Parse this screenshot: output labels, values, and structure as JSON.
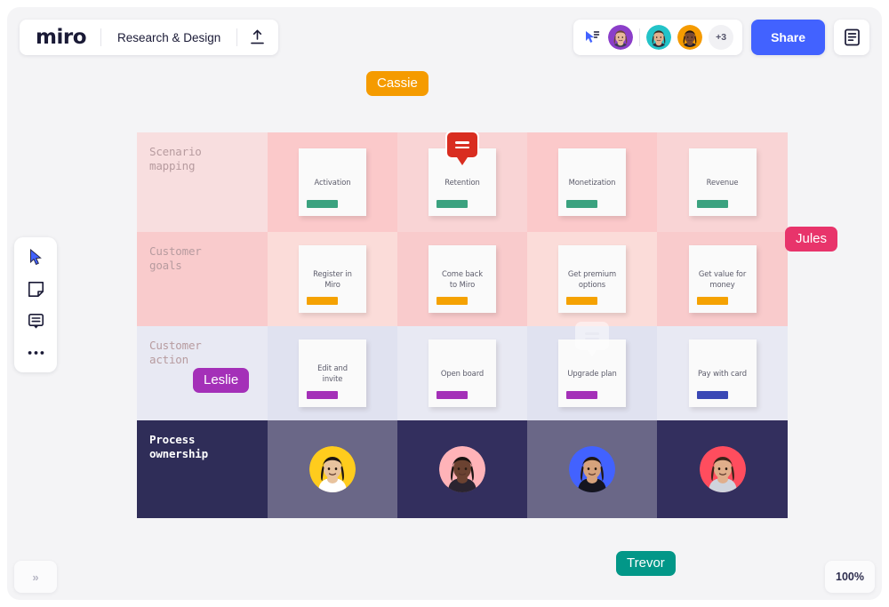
{
  "header": {
    "logo": "miro",
    "board_name": "Research & Design",
    "upload_icon": "upload-icon",
    "follow_icon": "follow-cursor-icon",
    "share_label": "Share",
    "notes_icon": "notes-panel-icon",
    "overflow_count": "+3",
    "collaborators": [
      {
        "name": "collaborator-1",
        "ring": "#8b3ec9",
        "skin": "#e8b99a",
        "hair": "#6d4535",
        "shirt": "#3d3d55"
      },
      {
        "name": "collaborator-2",
        "ring": "#23c3c8",
        "skin": "#e2b08e",
        "hair": "#3a2a22",
        "shirt": "#2a2a3a"
      },
      {
        "name": "collaborator-3",
        "ring": "#f59b00",
        "skin": "#7a4b34",
        "hair": "#231510",
        "shirt": "#1e1e2c"
      }
    ]
  },
  "toolbar": {
    "items": [
      {
        "name": "select-tool",
        "icon": "cursor-icon",
        "active": true
      },
      {
        "name": "sticky-note-tool",
        "icon": "sticky-note-icon",
        "active": false
      },
      {
        "name": "comment-tool",
        "icon": "comment-icon",
        "active": false
      },
      {
        "name": "more-tools",
        "icon": "ellipsis-icon",
        "active": false
      }
    ]
  },
  "footer": {
    "expand_icon": "chevron-double-right-icon",
    "zoom_level": "100%"
  },
  "matrix": {
    "rows": [
      {
        "label": "Scenario\nmapping",
        "label_style": "light",
        "header_bg": "#f8dedf",
        "cell_bgs": [
          "#fbc9ca",
          "#f9d4d5",
          "#fbc9ca",
          "#f9d4d5"
        ],
        "cards": [
          {
            "text": "Activation",
            "bar_color": "#3ba27f",
            "badge": null
          },
          {
            "text": "Retention",
            "bar_color": "#3ba27f",
            "badge": {
              "type": "comment-badge",
              "color": "#d92d20"
            }
          },
          {
            "text": "Monetization",
            "bar_color": "#3ba27f",
            "badge": null
          },
          {
            "text": "Revenue",
            "bar_color": "#3ba27f",
            "badge": null
          }
        ]
      },
      {
        "label": "Customer\ngoals",
        "label_style": "light",
        "header_bg": "#f9cbcc",
        "cell_bgs": [
          "#fbdcd9",
          "#f9cbcc",
          "#fbdcd9",
          "#f9cbcc"
        ],
        "cards": [
          {
            "text": "Register in\nMiro",
            "bar_color": "#f5a202",
            "badge": null
          },
          {
            "text": "Come back\nto Miro",
            "bar_color": "#f5a202",
            "badge": null
          },
          {
            "text": "Get premium\noptions",
            "bar_color": "#f5a202",
            "badge": null
          },
          {
            "text": "Get value for\nmoney",
            "bar_color": "#f5a202",
            "badge": null
          }
        ]
      },
      {
        "label": "Customer\naction",
        "label_style": "light",
        "header_bg": "#e8e9f3",
        "cell_bgs": [
          "#e0e2f0",
          "#e8e9f3",
          "#e0e2f0",
          "#e8e9f3"
        ],
        "cards": [
          {
            "text": "Edit and\ninvite",
            "bar_color": "#a430b8",
            "badge": null
          },
          {
            "text": "Open board",
            "bar_color": "#a430b8",
            "badge": null
          },
          {
            "text": "Upgrade plan",
            "bar_color": "#a430b8",
            "badge": {
              "type": "comment-badge-placeholder",
              "color": "#ffffff"
            }
          },
          {
            "text": "Pay with card",
            "bar_color": "#3a48b5",
            "badge": null
          }
        ]
      },
      {
        "label": "Process\nownership",
        "label_style": "dark",
        "header_bg": "#2f2d58",
        "cell_bgs": [
          "#6a6787",
          "#332f5e",
          "#6a6787",
          "#332f5e"
        ],
        "owners": [
          {
            "name": "owner-avatar-1",
            "ring": "#ffcc1d",
            "skin": "#e8c39e",
            "hair": "#1c1512",
            "shirt": "#ffffff"
          },
          {
            "name": "owner-avatar-2",
            "ring": "#ffb3b8",
            "skin": "#6b4231",
            "hair": "#181210",
            "shirt": "#2a2430"
          },
          {
            "name": "owner-avatar-3",
            "ring": "#4262ff",
            "skin": "#d6a27c",
            "hair": "#201713",
            "shirt": "#15151f"
          },
          {
            "name": "owner-avatar-4",
            "ring": "#ff4d5e",
            "skin": "#e0ae8b",
            "hair": "#3c2419",
            "shirt": "#cfd4dd"
          }
        ]
      }
    ]
  },
  "cursors": [
    {
      "name": "Cassie",
      "color": "#f59b00"
    },
    {
      "name": "Jules",
      "color": "#e8346b"
    },
    {
      "name": "Leslie",
      "color": "#a430b8"
    },
    {
      "name": "Trevor",
      "color": "#029788"
    }
  ]
}
